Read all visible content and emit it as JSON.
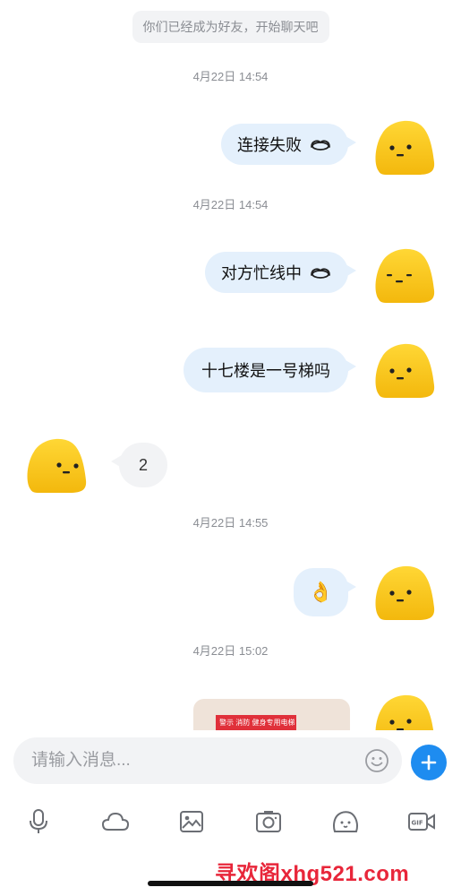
{
  "system_notice": "你们已经成为好友，开始聊天吧",
  "timestamps": [
    "4月22日 14:54",
    "4月22日 14:54",
    "4月22日 14:55",
    "4月22日 15:02"
  ],
  "messages": [
    {
      "direction": "out",
      "text": "连接失败",
      "status_icon": "link-fail-icon"
    },
    {
      "direction": "out",
      "text": "对方忙线中",
      "status_icon": "link-fail-icon"
    },
    {
      "direction": "out",
      "text": "十七楼是一号梯吗"
    },
    {
      "direction": "in",
      "text": "2"
    },
    {
      "direction": "out",
      "emoji": "👌"
    },
    {
      "direction": "out",
      "type": "image",
      "image_caption": "警示 消防 健身专用电梯"
    }
  ],
  "input": {
    "placeholder": "请输入消息..."
  },
  "toolbar": [
    "microphone-icon",
    "cloud-icon",
    "image-icon",
    "camera-icon",
    "emoji-face-icon",
    "gif-icon"
  ],
  "watermark": "寻欢阁xhg521.com",
  "colors": {
    "accent": "#1e8cf0",
    "out_bubble": "#e4f0fc",
    "in_bubble": "#f2f3f5",
    "avatar": "#f6c215"
  }
}
